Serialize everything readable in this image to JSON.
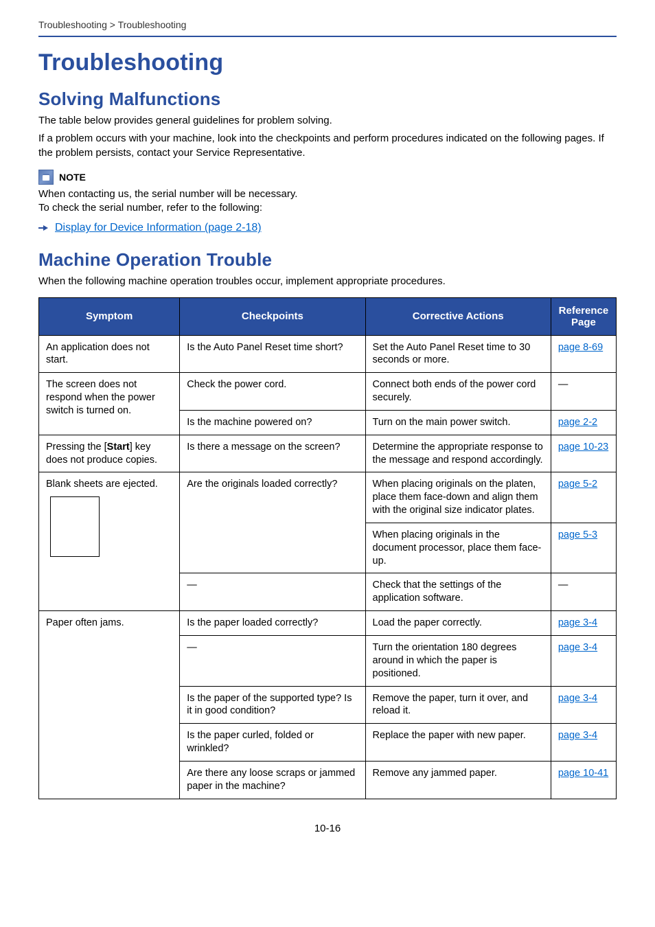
{
  "breadcrumb": "Troubleshooting > Troubleshooting",
  "headings": {
    "h1": "Troubleshooting",
    "h2a": "Solving Malfunctions",
    "h2b": "Machine Operation Trouble"
  },
  "intro": {
    "p1": "The table below provides general guidelines for problem solving.",
    "p2": "If a problem occurs with your machine, look into the checkpoints and perform procedures indicated on the following pages. If the problem persists, contact your Service Representative."
  },
  "note": {
    "label": "NOTE",
    "line1": "When contacting us, the serial number will be necessary.",
    "line2": "To check the serial number, refer to the following:",
    "link": "Display for Device Information (page 2-18)"
  },
  "machine_intro": "When the following machine operation troubles occur, implement appropriate procedures.",
  "table": {
    "headers": {
      "symptom": "Symptom",
      "checkpoints": "Checkpoints",
      "actions": "Corrective Actions",
      "reference": "Reference Page"
    },
    "rows": {
      "r0": {
        "symptom": "An application does not start.",
        "check": "Is the Auto Panel Reset time short?",
        "action": "Set the Auto Panel Reset time to 30 seconds or more.",
        "ref": "page 8-69"
      },
      "r1": {
        "symptom": "The screen does not respond when the power switch is turned on.",
        "check_a": "Check the power cord.",
        "action_a": "Connect both ends of the power cord securely.",
        "ref_a": "―",
        "check_b": "Is the machine powered on?",
        "action_b": "Turn on the main power switch.",
        "ref_b": "page 2-2"
      },
      "r2": {
        "symptom_prefix": "Pressing the [",
        "symptom_bold": "Start",
        "symptom_suffix": "] key does not produce copies.",
        "check": "Is there a message on the screen?",
        "action": "Determine the appropriate response to the message and respond accordingly.",
        "ref": "page 10-23"
      },
      "r3": {
        "symptom": "Blank sheets are ejected.",
        "check_a": "Are the originals loaded correctly?",
        "action_a": "When placing originals on the platen, place them face-down and align them with the original size indicator plates.",
        "ref_a": "page 5-2",
        "action_b": "When placing originals in the document processor, place them face-up.",
        "ref_b": "page 5-3",
        "check_c": "―",
        "action_c": "Check that the settings of the application software.",
        "ref_c": "―"
      },
      "r4": {
        "symptom": "Paper often jams.",
        "check_a": "Is the paper loaded correctly?",
        "action_a": "Load the paper correctly.",
        "ref_a": "page 3-4",
        "check_b": "―",
        "action_b": "Turn the orientation 180 degrees around in which the paper is positioned.",
        "ref_b": "page 3-4",
        "check_c": "Is the paper of the supported type? Is it in good condition?",
        "action_c": "Remove the paper, turn it over, and reload it.",
        "ref_c": "page 3-4",
        "check_d": "Is the paper curled, folded or wrinkled?",
        "action_d": "Replace the paper with new paper.",
        "ref_d": "page 3-4",
        "check_e": "Are there any loose scraps or jammed paper in the machine?",
        "action_e": "Remove any jammed paper.",
        "ref_e": "page 10-41"
      }
    }
  },
  "page_number": "10-16"
}
